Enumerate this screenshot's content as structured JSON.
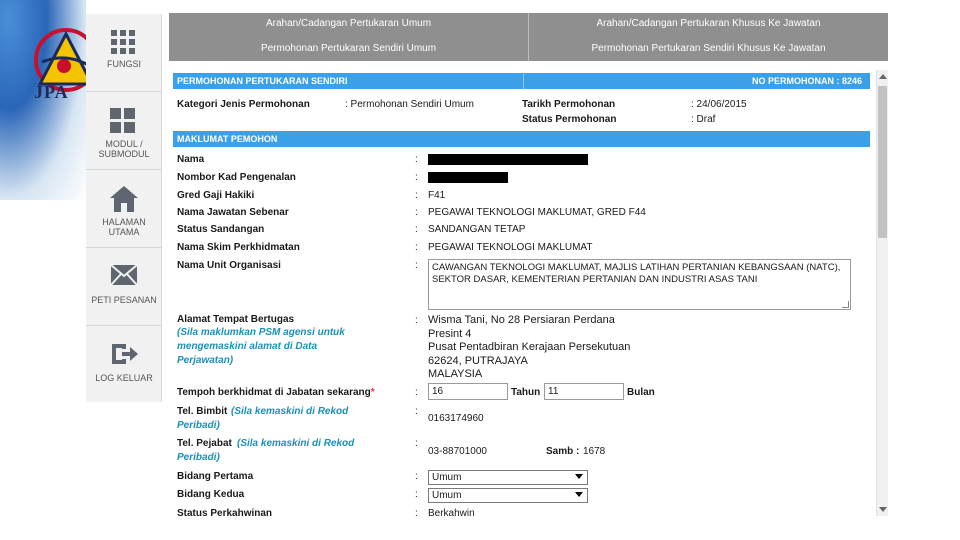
{
  "brand": {
    "logo_text": "JPA",
    "colors": {
      "accent": "#3aa0e8",
      "hint": "#1a8fb8",
      "topbar": "#8f8f8f"
    }
  },
  "sidenav": [
    {
      "label": "FUNGSI",
      "icon": "grid-icon"
    },
    {
      "label": "MODUL / SUBMODUL",
      "icon": "modules-icon"
    },
    {
      "label": "HALAMAN UTAMA",
      "icon": "home-icon"
    },
    {
      "label": "PETI PESANAN",
      "icon": "envelope-icon"
    },
    {
      "label": "LOG KELUAR",
      "icon": "logout-icon"
    }
  ],
  "tabs": [
    {
      "line1": "Arahan/Cadangan Pertukaran Umum",
      "line2": "Permohonan Pertukaran Sendiri Umum"
    },
    {
      "line1": "Arahan/Cadangan Pertukaran Khusus Ke Jawatan",
      "line2": "Permohonan Pertukaran Sendiri Khusus Ke Jawatan"
    }
  ],
  "header": {
    "title": "PERMOHONAN PERTUKARAN SENDIRI",
    "no_label": "NO PERMOHONAN : 8246",
    "kategori_label": "Kategori Jenis Permohonan",
    "kategori_value": ": Permohonan Sendiri Umum",
    "tarikh_label": "Tarikh Permohonan",
    "tarikh_value": ": 24/06/2015",
    "status_label": "Status Permohonan",
    "status_value": ": Draf"
  },
  "pemohon": {
    "title": "MAKLUMAT PEMOHON",
    "nama_label": "Nama",
    "kp_label": "Nombor Kad Pengenalan",
    "gred_label": "Gred Gaji Hakiki",
    "gred_value": "F41",
    "jawatan_label": "Nama Jawatan Sebenar",
    "jawatan_value": "PEGAWAI TEKNOLOGI MAKLUMAT, GRED F44",
    "sandangan_label": "Status Sandangan",
    "sandangan_value": "SANDANGAN TETAP",
    "skim_label": "Nama Skim Perkhidmatan",
    "skim_value": "PEGAWAI TEKNOLOGI MAKLUMAT",
    "unit_label": "Nama Unit Organisasi",
    "unit_value": "CAWANGAN TEKNOLOGI MAKLUMAT, MAJLIS LATIHAN PERTANIAN KEBANGSAAN (NATC), SEKTOR DASAR, KEMENTERIAN PERTANIAN DAN INDUSTRI ASAS TANI",
    "alamat_label": "Alamat Tempat Bertugas",
    "alamat_hint_1": "(Sila maklumkan PSM agensi untuk",
    "alamat_hint_2": "mengemaskini alamat di Data",
    "alamat_hint_3": "Perjawatan)",
    "alamat_lines": [
      "Wisma Tani, No 28 Persiaran Perdana",
      "Presint 4",
      "Pusat Pentadbiran Kerajaan Persekutuan",
      "62624, PUTRAJAYA",
      "MALAYSIA"
    ],
    "tempoh_label": "Tempoh berkhidmat di Jabatan sekarang",
    "tempoh_req": "*",
    "tahun_value": "16",
    "tahun_label": "Tahun",
    "bulan_value": "11",
    "bulan_label": "Bulan",
    "bimbit_label": "Tel. Bimbit",
    "bimbit_hint_1": "(Sila kemaskini di Rekod",
    "bimbit_hint_2": "Peribadi)",
    "bimbit_value": "0163174960",
    "pejabat_label": "Tel. Pejabat",
    "pejabat_hint_1": "(Sila kemaskini di Rekod",
    "pejabat_hint_2": "Peribadi)",
    "pejabat_value": "03-88701000",
    "samb_label": "Samb :",
    "samb_value": "1678",
    "bidang1_label": "Bidang Pertama",
    "bidang1_value": "Umum",
    "bidang2_label": "Bidang Kedua",
    "bidang2_value": "Umum",
    "kahwin_label": "Status Perkahwinan",
    "kahwin_value": "Berkahwin",
    "colon": ":"
  }
}
